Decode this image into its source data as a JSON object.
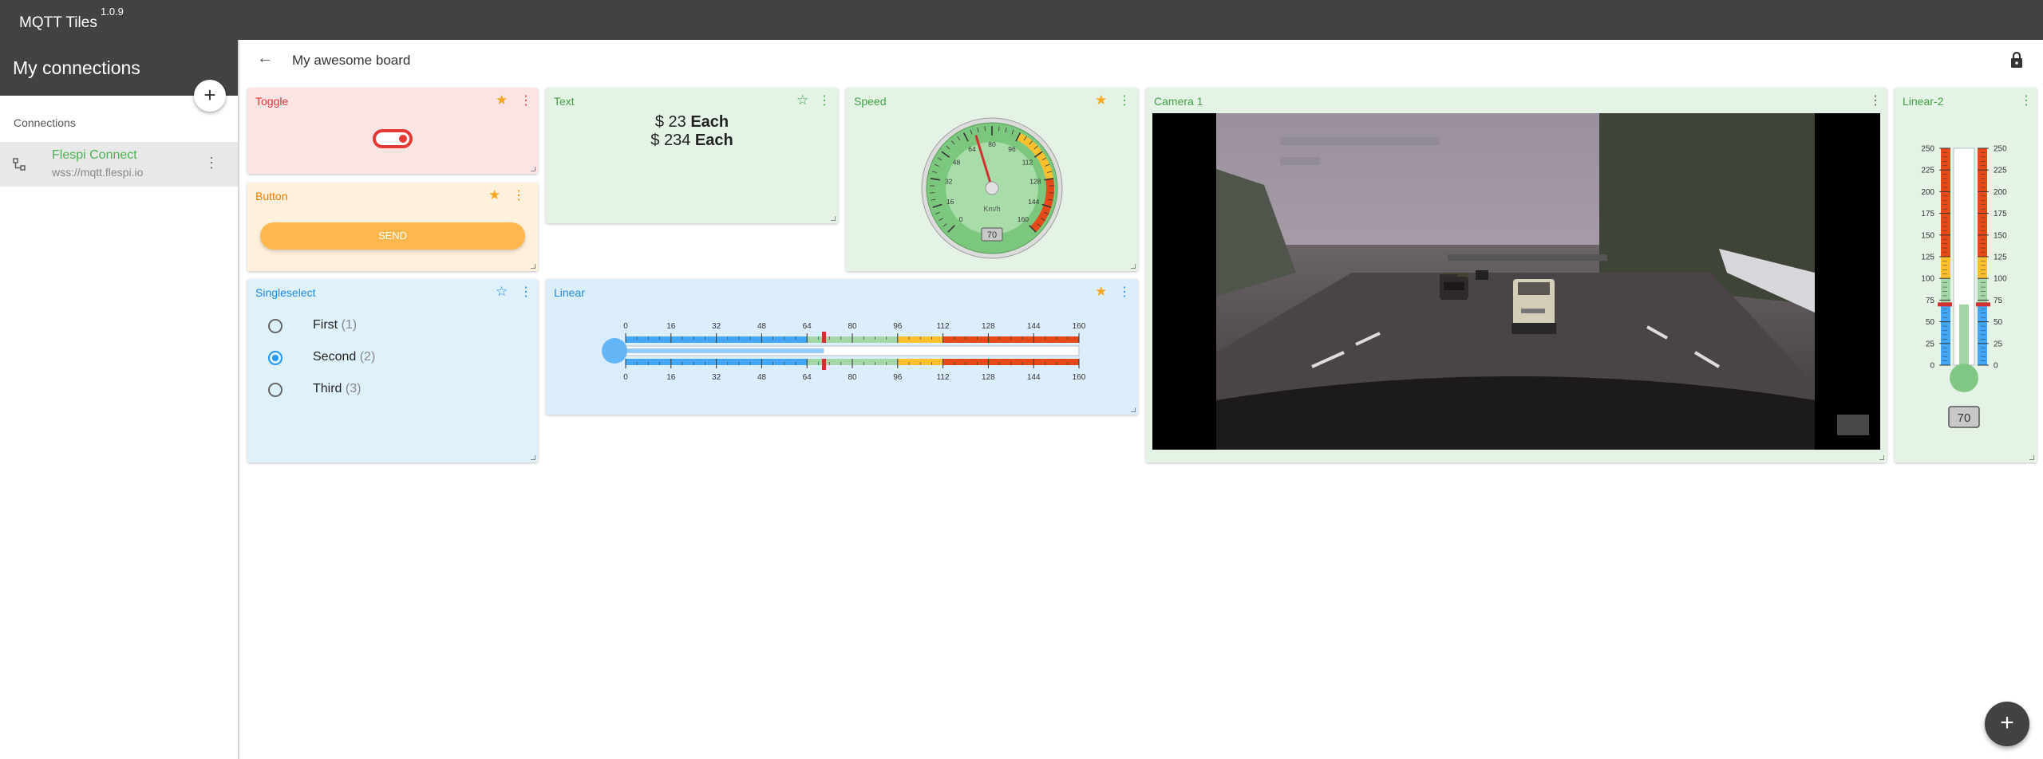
{
  "app": {
    "title": "MQTT Tiles",
    "version": "1.0.9"
  },
  "drawer": {
    "title": "My connections",
    "add_icon": "plus-icon",
    "section_label": "Connections",
    "connections": [
      {
        "name": "Flespi Connect",
        "url": "wss://mqtt.flespi.io",
        "icon": "connection-icon",
        "active_color": "#4caf50"
      }
    ]
  },
  "board": {
    "title": "My awesome board",
    "back_icon": "arrow-left-icon",
    "lock_icon": "lock-icon"
  },
  "tiles": {
    "toggle": {
      "title": "Toggle",
      "color": "#e53935",
      "starred": true,
      "state": "on"
    },
    "button": {
      "title": "Button",
      "color": "#f57c00",
      "starred": true,
      "label": "SEND"
    },
    "text": {
      "title": "Text",
      "color": "#43a047",
      "starred": false,
      "lines": [
        {
          "prefix": "$ ",
          "value": "23",
          "suffix": " Each"
        },
        {
          "prefix": "$ ",
          "value": "234",
          "suffix": " Each"
        }
      ]
    },
    "speed": {
      "title": "Speed",
      "color": "#43a047",
      "starred": true,
      "unit": "Km/h",
      "value": "70",
      "min": 0,
      "max": 160,
      "ticks": [
        "0",
        "16",
        "32",
        "48",
        "64",
        "80",
        "96",
        "112",
        "128",
        "144",
        "160"
      ]
    },
    "camera": {
      "title": "Camera 1",
      "color": "#43a047"
    },
    "linear2": {
      "title": "Linear-2",
      "color": "#43a047",
      "value": "70",
      "min": 0,
      "max": 250,
      "ticks": [
        "250",
        "225",
        "200",
        "175",
        "150",
        "125",
        "100",
        "75",
        "50",
        "25",
        "0"
      ]
    },
    "singleselect": {
      "title": "Singleselect",
      "color": "#1e88e5",
      "starred": false,
      "selected": 1,
      "options": [
        {
          "label": "First",
          "count": "(1)"
        },
        {
          "label": "Second",
          "count": "(2)"
        },
        {
          "label": "Third",
          "count": "(3)"
        }
      ]
    },
    "linear": {
      "title": "Linear",
      "color": "#1e88e5",
      "starred": true,
      "value": 70,
      "min": 0,
      "max": 160,
      "ticks": [
        "0",
        "16",
        "32",
        "48",
        "64",
        "80",
        "96",
        "112",
        "128",
        "144",
        "160"
      ]
    }
  },
  "colors": {
    "appbar": "#424242",
    "star": "#f9a825",
    "blue_zone": "#42a5f5",
    "green_zone": "#a5d6a7",
    "yellow_zone": "#fbc02d",
    "red_zone": "#e64a19"
  },
  "fab": {
    "icon": "plus-icon"
  }
}
